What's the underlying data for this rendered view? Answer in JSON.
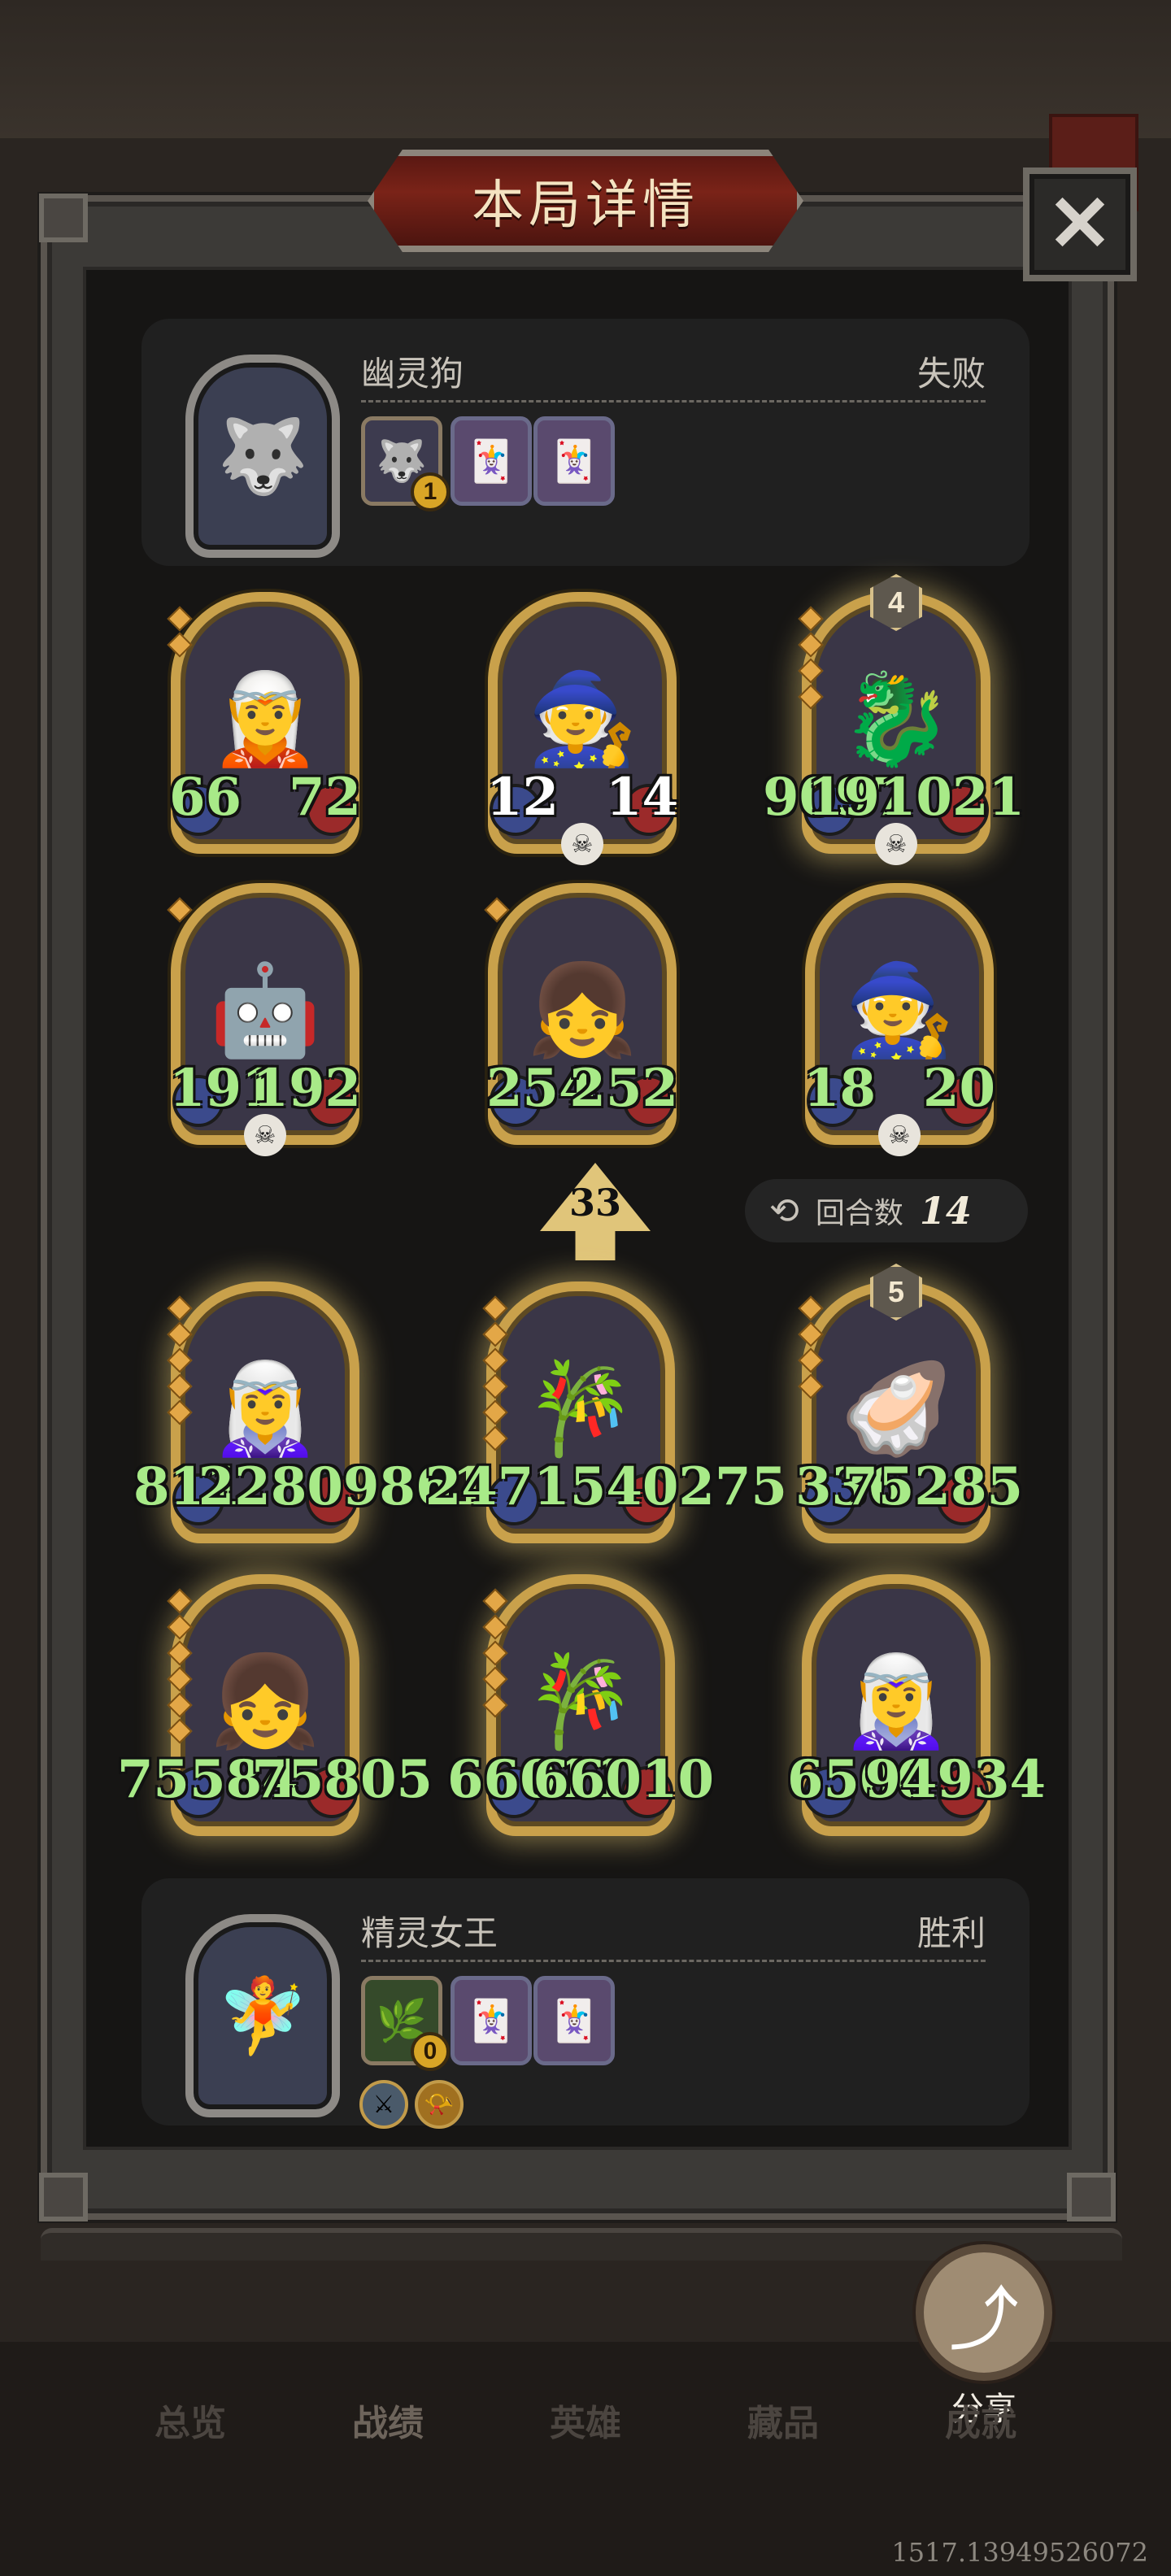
{
  "title": "本局详情",
  "close_icon": "✕",
  "top_player": {
    "name": "幽灵狗",
    "result": "失败",
    "portrait_icon": "wolf-icon",
    "hero_badge": "1"
  },
  "bottom_player": {
    "name": "精灵女王",
    "result": "胜利",
    "portrait_icon": "elf-queen-icon",
    "hero_badge": "0"
  },
  "top_board": [
    {
      "atk": "66",
      "hp": "72"
    },
    {
      "atk": "12",
      "hp": "14"
    },
    {
      "atk": "9097",
      "hp": "191021",
      "tier": "4"
    },
    {
      "atk": "191",
      "hp": "192"
    },
    {
      "atk": "254",
      "hp": "252"
    },
    {
      "atk": "18",
      "hp": "20"
    }
  ],
  "upgrade_value": "33",
  "rounds": {
    "label": "回合数",
    "value": "14"
  },
  "bottom_board": [
    {
      "atk": "811",
      "hp": "22809861"
    },
    {
      "atk": "15",
      "hp": "2471540275"
    },
    {
      "atk": "336",
      "hp": "75285",
      "tier": "5"
    },
    {
      "atk": "75584",
      "hp": "75805"
    },
    {
      "atk": "66011",
      "hp": "66010"
    },
    {
      "atk": "6506",
      "hp": "94934"
    }
  ],
  "share_label": "分享",
  "nav": [
    "总览",
    "战绩",
    "英雄",
    "藏品",
    "成就"
  ],
  "version": "1517.13949526072"
}
